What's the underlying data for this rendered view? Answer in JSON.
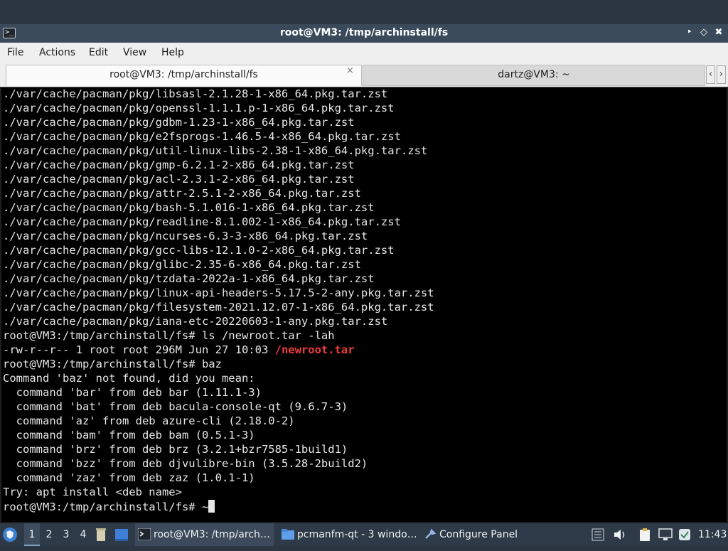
{
  "window": {
    "title": "root@VM3: /tmp/archinstall/fs",
    "minimize_glyph": "‣",
    "maximize_glyph": "◇",
    "close_glyph": "✖"
  },
  "menu": [
    "File",
    "Actions",
    "Edit",
    "View",
    "Help"
  ],
  "tabs": {
    "active_label": "root@VM3: /tmp/archinstall/fs",
    "inactive_label": "dartz@VM3: ~",
    "close_glyph": "×",
    "scroll_left": "‹",
    "scroll_right": "›"
  },
  "terminal": {
    "lines": [
      "./var/cache/pacman/pkg/libsasl-2.1.28-1-x86_64.pkg.tar.zst",
      "./var/cache/pacman/pkg/openssl-1.1.1.p-1-x86_64.pkg.tar.zst",
      "./var/cache/pacman/pkg/gdbm-1.23-1-x86_64.pkg.tar.zst",
      "./var/cache/pacman/pkg/e2fsprogs-1.46.5-4-x86_64.pkg.tar.zst",
      "./var/cache/pacman/pkg/util-linux-libs-2.38-1-x86_64.pkg.tar.zst",
      "./var/cache/pacman/pkg/gmp-6.2.1-2-x86_64.pkg.tar.zst",
      "./var/cache/pacman/pkg/acl-2.3.1-2-x86_64.pkg.tar.zst",
      "./var/cache/pacman/pkg/attr-2.5.1-2-x86_64.pkg.tar.zst",
      "./var/cache/pacman/pkg/bash-5.1.016-1-x86_64.pkg.tar.zst",
      "./var/cache/pacman/pkg/readline-8.1.002-1-x86_64.pkg.tar.zst",
      "./var/cache/pacman/pkg/ncurses-6.3-3-x86_64.pkg.tar.zst",
      "./var/cache/pacman/pkg/gcc-libs-12.1.0-2-x86_64.pkg.tar.zst",
      "./var/cache/pacman/pkg/glibc-2.35-6-x86_64.pkg.tar.zst",
      "./var/cache/pacman/pkg/tzdata-2022a-1-x86_64.pkg.tar.zst",
      "./var/cache/pacman/pkg/linux-api-headers-5.17.5-2-any.pkg.tar.zst",
      "./var/cache/pacman/pkg/filesystem-2021.12.07-1-x86_64.pkg.tar.zst",
      "./var/cache/pacman/pkg/iana-etc-20220603-1-any.pkg.tar.zst",
      "root@VM3:/tmp/archinstall/fs# ls /newroot.tar -lah"
    ],
    "ls_output_prefix": "-rw-r--r-- 1 root root 296M Jun 27 10:03 ",
    "ls_output_file": "/newroot.tar",
    "lines_after": [
      "root@VM3:/tmp/archinstall/fs# baz",
      "Command 'baz' not found, did you mean:",
      "  command 'bar' from deb bar (1.11.1-3)",
      "  command 'bat' from deb bacula-console-qt (9.6.7-3)",
      "  command 'az' from deb azure-cli (2.18.0-2)",
      "  command 'bam' from deb bam (0.5.1-3)",
      "  command 'brz' from deb brz (3.2.1+bzr7585-1build1)",
      "  command 'bzz' from deb djvulibre-bin (3.5.28-2build2)",
      "  command 'zaz' from deb zaz (1.0.1-1)",
      "Try: apt install <deb name>"
    ],
    "prompt": "root@VM3:/tmp/archinstall/fs# ~",
    "colors": {
      "background": "#000000",
      "text": "#e6e6e6",
      "highlight": "#ef3d3d"
    }
  },
  "taskbar": {
    "desktops": [
      "1",
      "2",
      "3",
      "4"
    ],
    "tasks": [
      {
        "label": "root@VM3: /tmp/arch…",
        "icon": "terminal-icon"
      },
      {
        "label": "pcmanfm-qt - 3 windo…",
        "icon": "folder-icon"
      },
      {
        "label": "Configure Panel",
        "icon": "settings-icon"
      }
    ],
    "clock": "11:43"
  }
}
